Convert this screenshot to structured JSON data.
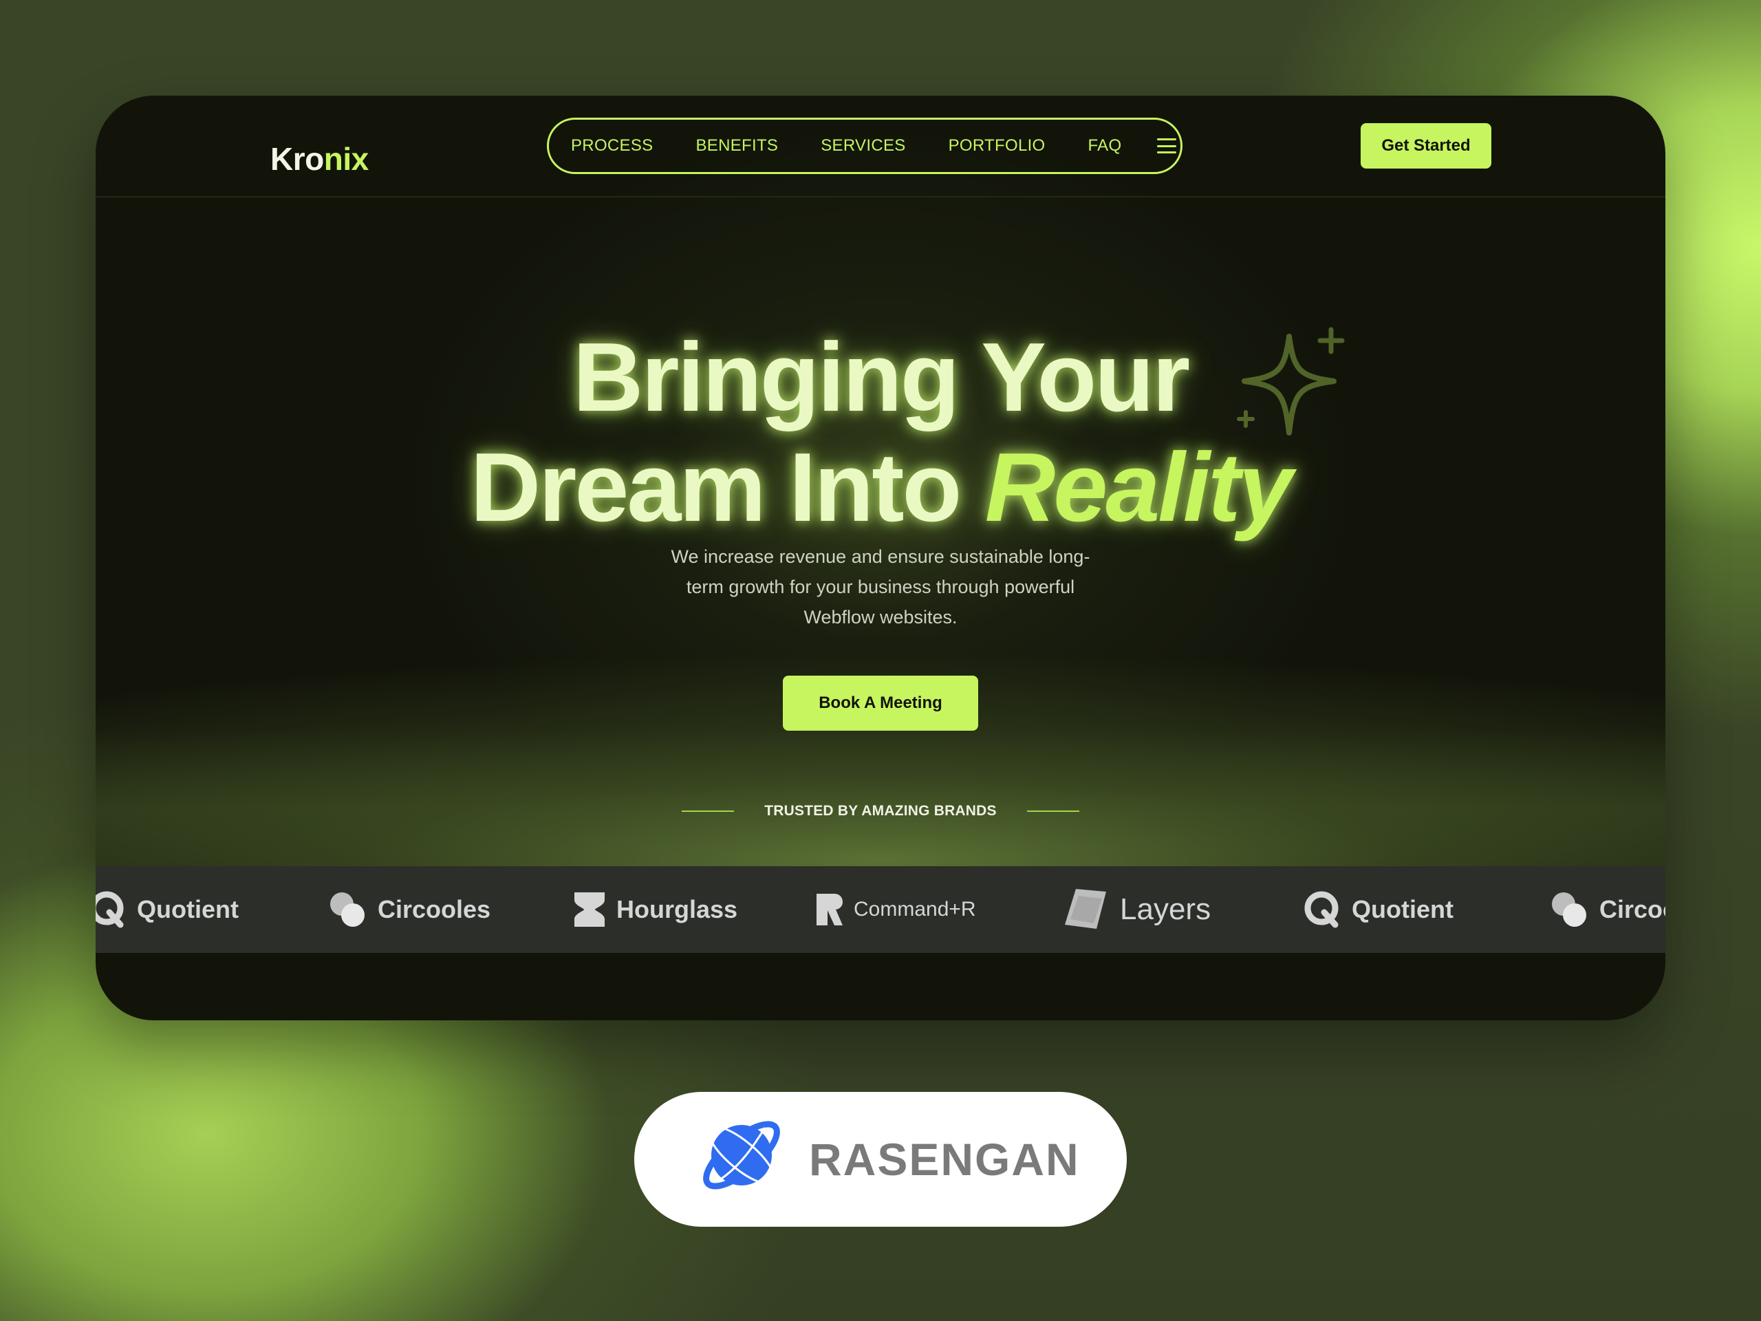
{
  "logo": {
    "part1": "Kro",
    "part2": "nix"
  },
  "nav": {
    "items": [
      "PROCESS",
      "BENEFITS",
      "SERVICES",
      "PORTFOLIO",
      "FAQ"
    ],
    "cta": "Get Started"
  },
  "hero": {
    "line1": "Bringing Your",
    "line2_main": "Dream Into",
    "line2_accent": "Reality",
    "subtitle": "We increase revenue and ensure sustainable long-term growth for your business through powerful Webflow websites.",
    "cta": "Book A Meeting"
  },
  "trusted": {
    "label": "TRUSTED BY AMAZING BRANDS"
  },
  "brands": [
    "Quotient",
    "Circooles",
    "Hourglass",
    "Command+R",
    "Layers",
    "Quotient",
    "Circooles"
  ],
  "badge": {
    "text": "RASENGAN"
  },
  "colors": {
    "accent": "#c6f55f",
    "card_bg": "#12140a",
    "strip_bg": "#2c2e2a",
    "badge_blue": "#2f6cf0"
  }
}
